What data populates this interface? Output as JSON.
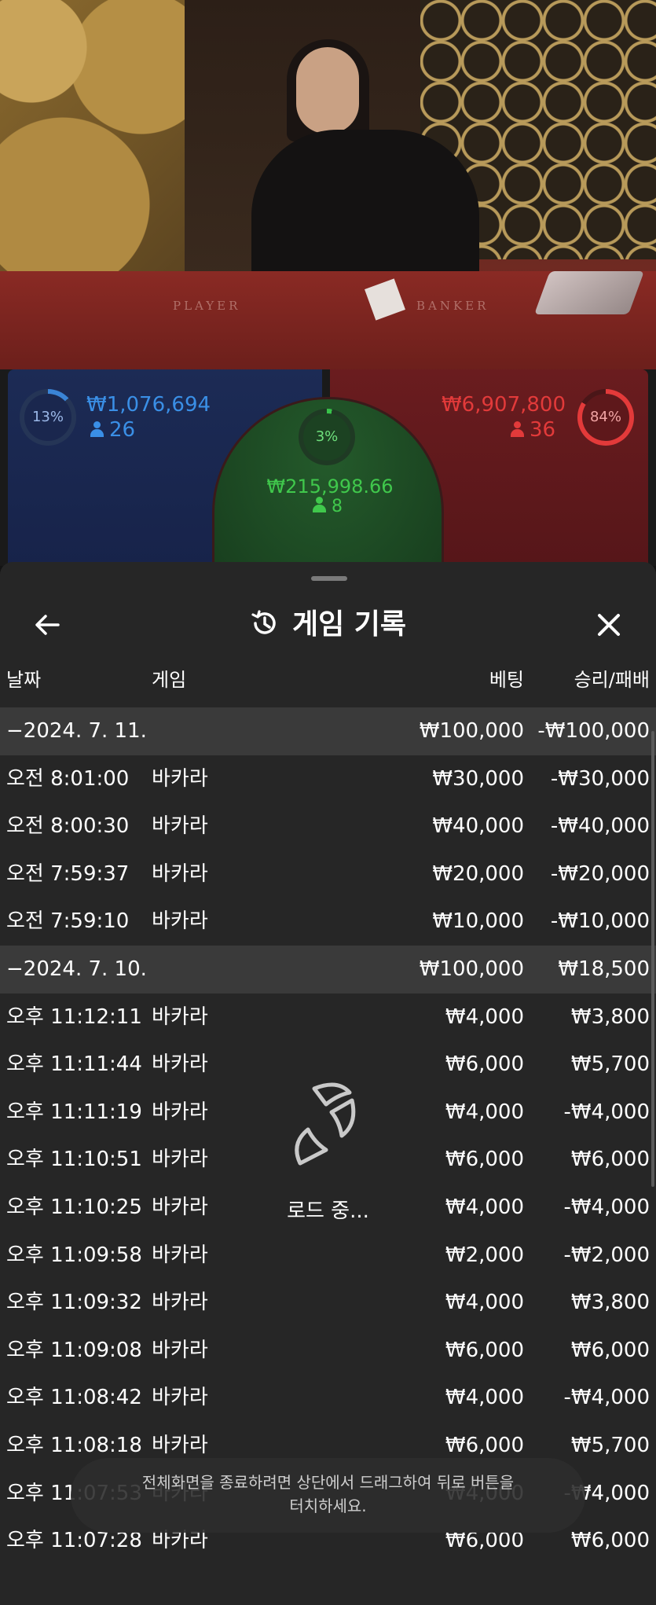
{
  "video": {
    "table_player_label": "PLAYER",
    "table_banker_label": "BANKER"
  },
  "bets": {
    "player": {
      "pct": "13%",
      "amount": "₩1,076,694",
      "count": "26",
      "fill": 0.13,
      "color": "#3a8fe6"
    },
    "tie": {
      "pct": "3%",
      "amount": "₩215,998.66",
      "count": "8",
      "fill": 0.03,
      "color": "#40c84c"
    },
    "banker": {
      "pct": "84%",
      "amount": "₩6,907,800",
      "count": "36",
      "fill": 0.84,
      "color": "#e23a3a"
    }
  },
  "sheet": {
    "title": "게임 기록",
    "back_icon": "arrow-left-icon",
    "history_icon": "history-icon",
    "close_icon": "close-icon",
    "columns": {
      "date": "날짜",
      "game": "게임",
      "bet": "베팅",
      "result": "승리/패배"
    },
    "rows": [
      {
        "type": "date",
        "date": "−2024. 7. 11.",
        "game": "",
        "bet": "₩100,000",
        "result": "-₩100,000"
      },
      {
        "type": "entry",
        "date": "오전 8:01:00",
        "game": "바카라",
        "bet": "₩30,000",
        "result": "-₩30,000"
      },
      {
        "type": "entry",
        "date": "오전 8:00:30",
        "game": "바카라",
        "bet": "₩40,000",
        "result": "-₩40,000"
      },
      {
        "type": "entry",
        "date": "오전 7:59:37",
        "game": "바카라",
        "bet": "₩20,000",
        "result": "-₩20,000"
      },
      {
        "type": "entry",
        "date": "오전 7:59:10",
        "game": "바카라",
        "bet": "₩10,000",
        "result": "-₩10,000"
      },
      {
        "type": "date",
        "date": "−2024. 7. 10.",
        "game": "",
        "bet": "₩100,000",
        "result": "₩18,500"
      },
      {
        "type": "entry",
        "date": "오후 11:12:11",
        "game": "바카라",
        "bet": "₩4,000",
        "result": "₩3,800"
      },
      {
        "type": "entry",
        "date": "오후 11:11:44",
        "game": "바카라",
        "bet": "₩6,000",
        "result": "₩5,700"
      },
      {
        "type": "entry",
        "date": "오후 11:11:19",
        "game": "바카라",
        "bet": "₩4,000",
        "result": "-₩4,000"
      },
      {
        "type": "entry",
        "date": "오후 11:10:51",
        "game": "바카라",
        "bet": "₩6,000",
        "result": "₩6,000"
      },
      {
        "type": "entry",
        "date": "오후 11:10:25",
        "game": "바카라",
        "bet": "₩4,000",
        "result": "-₩4,000"
      },
      {
        "type": "entry",
        "date": "오후 11:09:58",
        "game": "바카라",
        "bet": "₩2,000",
        "result": "-₩2,000"
      },
      {
        "type": "entry",
        "date": "오후 11:09:32",
        "game": "바카라",
        "bet": "₩4,000",
        "result": "₩3,800"
      },
      {
        "type": "entry",
        "date": "오후 11:09:08",
        "game": "바카라",
        "bet": "₩6,000",
        "result": "₩6,000"
      },
      {
        "type": "entry",
        "date": "오후 11:08:42",
        "game": "바카라",
        "bet": "₩4,000",
        "result": "-₩4,000"
      },
      {
        "type": "entry",
        "date": "오후 11:08:18",
        "game": "바카라",
        "bet": "₩6,000",
        "result": "₩5,700"
      },
      {
        "type": "entry",
        "date": "오후 11:07:53",
        "game": "바카라",
        "bet": "₩4,000",
        "result": "-₩4,000"
      },
      {
        "type": "entry",
        "date": "오후 11:07:28",
        "game": "바카라",
        "bet": "₩6,000",
        "result": "₩6,000"
      }
    ],
    "loading_text": "로드 중...",
    "toast_line1": "전체화면을 종료하려면 상단에서 드래그하여 뒤로 버튼을",
    "toast_line2": "터치하세요."
  }
}
